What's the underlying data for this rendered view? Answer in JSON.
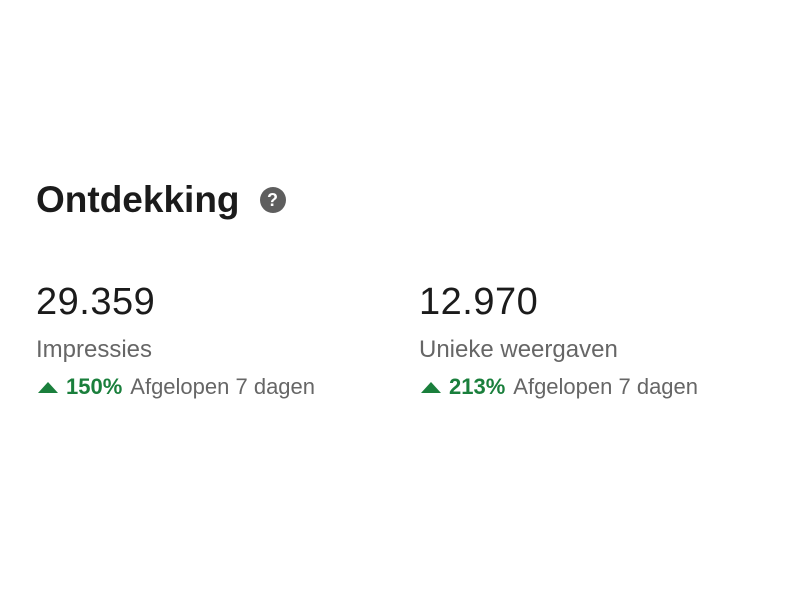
{
  "section": {
    "title": "Ontdekking",
    "help_icon": "help-circle-icon",
    "help_glyph": "?"
  },
  "metrics": [
    {
      "value": "29.359",
      "label": "Impressies",
      "change": "150%",
      "direction": "up",
      "period": "Afgelopen 7 dagen"
    },
    {
      "value": "12.970",
      "label": "Unieke weergaven",
      "change": "213%",
      "direction": "up",
      "period": "Afgelopen 7 dagen"
    }
  ],
  "colors": {
    "positive": "#1a7f3c",
    "muted_text": "#666666",
    "primary_text": "#1b1b1b"
  }
}
